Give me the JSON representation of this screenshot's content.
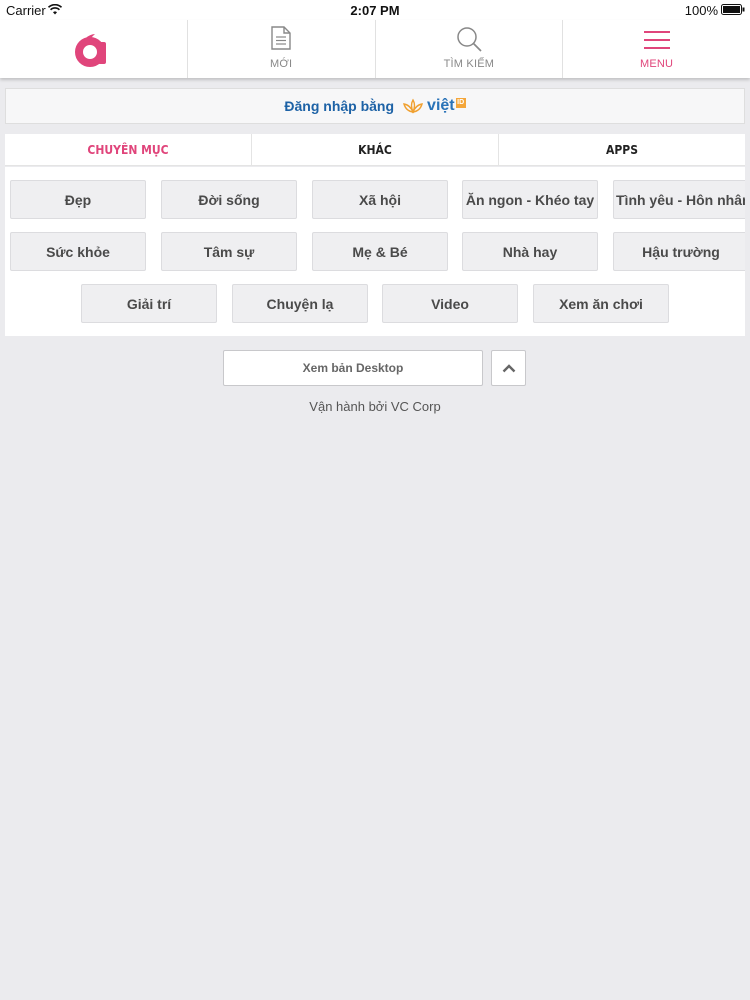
{
  "status_bar": {
    "carrier": "Carrier",
    "time": "2:07 PM",
    "battery": "100%"
  },
  "header": {
    "logo_icon": "afamily-logo-icon",
    "items": [
      {
        "label": "MỚI",
        "icon": "document-icon"
      },
      {
        "label": "TÌM KIẾM",
        "icon": "search-icon"
      },
      {
        "label": "MENU",
        "icon": "hamburger-icon"
      }
    ]
  },
  "login": {
    "text": "Đăng nhập bằng",
    "brand": "việt",
    "badge": "ID"
  },
  "tabs": [
    {
      "label": "CHUYÊN MỤC",
      "active": true
    },
    {
      "label": "KHÁC",
      "active": false
    },
    {
      "label": "APPS",
      "active": false
    }
  ],
  "categories": [
    "Đẹp",
    "Đời sống",
    "Xã hội",
    "Ăn ngon - Khéo tay",
    "Tình yêu - Hôn nhân",
    "Sức khỏe",
    "Tâm sự",
    "Mẹ & Bé",
    "Nhà hay",
    "Hậu trường",
    "Giải trí",
    "Chuyện lạ",
    "Video",
    "Xem ăn chơi"
  ],
  "footer": {
    "desktop_label": "Xem bản Desktop",
    "powered_by": "Vận hành bởi VC Corp"
  },
  "colors": {
    "accent": "#e0457b",
    "link": "#1d62a6",
    "background": "#ebebee"
  }
}
